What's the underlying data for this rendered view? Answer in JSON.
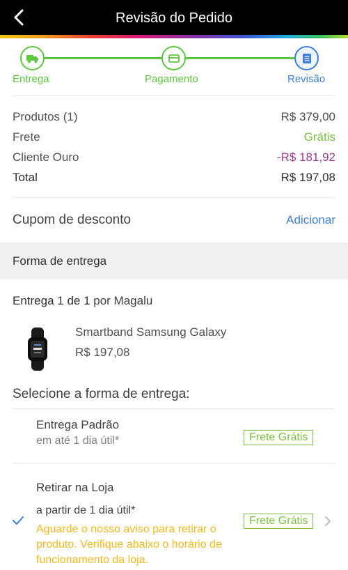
{
  "header": {
    "title": "Revisão do Pedido",
    "back_icon": "chevron-left-icon"
  },
  "steps": [
    {
      "label": "Entrega",
      "icon": "truck-icon",
      "state": "done"
    },
    {
      "label": "Pagamento",
      "icon": "card-icon",
      "state": "done"
    },
    {
      "label": "Revisão",
      "icon": "document-icon",
      "state": "current"
    }
  ],
  "summary": {
    "products_label": "Produtos (1)",
    "products_value": "R$ 379,00",
    "shipping_label": "Frete",
    "shipping_value": "Grátis",
    "gold_label": "Cliente Ouro",
    "gold_value": "-R$ 181,92",
    "total_label": "Total",
    "total_value": "R$ 197,08"
  },
  "coupon": {
    "label": "Cupom de desconto",
    "action": "Adicionar"
  },
  "delivery_section": {
    "header": "Forma de entrega"
  },
  "delivery": {
    "title_strong": "Entrega 1 de 1",
    "title_rest": " por Magalu",
    "product_name": "Smartband Samsung Galaxy",
    "product_price": "R$ 197,08",
    "select_title": "Selecione a forma de entrega:"
  },
  "options": [
    {
      "title": "Entrega Padrão",
      "subtitle": "em até 1 dia útil*",
      "badge": "Frete Grátis",
      "selected": false
    },
    {
      "title": "Retirar na Loja",
      "subtitle": "a partir de 1 dia útil*",
      "note": "Aguarde o nosso aviso para retirar o produto. Verifique abaixo o horário de funcionamento da loja.",
      "badge": "Frete Grátis",
      "selected": true
    }
  ],
  "colors": {
    "accent_green": "#7ac143",
    "accent_blue": "#3d7fd6",
    "discount_purple": "#9e3a8c",
    "note_yellow": "#f2b81c"
  }
}
